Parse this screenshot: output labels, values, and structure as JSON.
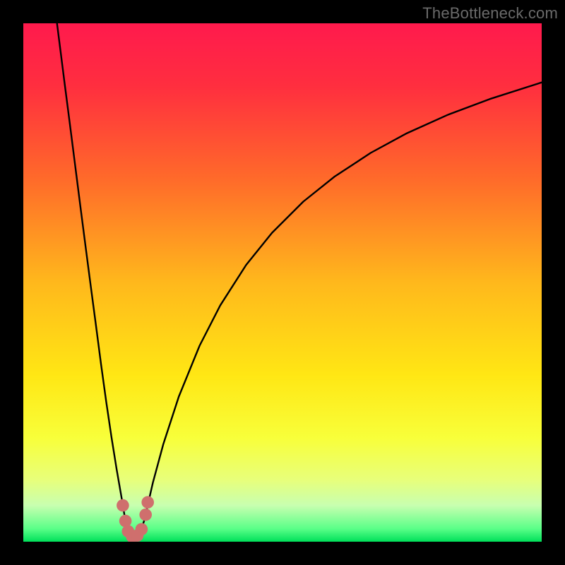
{
  "watermark": "TheBottleneck.com",
  "colors": {
    "frame": "#000000",
    "curve_stroke": "#000000",
    "marker_fill": "#cf6f6d",
    "gradient_stops": [
      {
        "offset": 0.0,
        "color": "#ff1a4d"
      },
      {
        "offset": 0.12,
        "color": "#ff2e3f"
      },
      {
        "offset": 0.3,
        "color": "#ff6a2a"
      },
      {
        "offset": 0.5,
        "color": "#ffb81c"
      },
      {
        "offset": 0.68,
        "color": "#ffe714"
      },
      {
        "offset": 0.8,
        "color": "#f8ff3a"
      },
      {
        "offset": 0.88,
        "color": "#e8ff7a"
      },
      {
        "offset": 0.93,
        "color": "#c8ffb0"
      },
      {
        "offset": 0.975,
        "color": "#5aff88"
      },
      {
        "offset": 1.0,
        "color": "#00e05a"
      }
    ]
  },
  "chart_data": {
    "type": "line",
    "title": "",
    "xlabel": "",
    "ylabel": "",
    "xlim": [
      0,
      100
    ],
    "ylim": [
      0,
      100
    ],
    "series": [
      {
        "name": "left-branch",
        "x": [
          6.5,
          8,
          9,
          10,
          11,
          12,
          13,
          14,
          15,
          16,
          17,
          18,
          19,
          19.7
        ],
        "y": [
          100,
          88.2,
          80.4,
          72.6,
          64.8,
          57.0,
          49.4,
          41.8,
          34.2,
          27.0,
          20.2,
          14.0,
          8.2,
          4.0
        ]
      },
      {
        "name": "floor",
        "x": [
          19.7,
          20.5,
          21.5,
          22.5,
          23.3
        ],
        "y": [
          4.0,
          1.6,
          1.0,
          1.6,
          4.0
        ]
      },
      {
        "name": "right-branch",
        "x": [
          23.3,
          25,
          27,
          30,
          34,
          38,
          43,
          48,
          54,
          60,
          67,
          74,
          82,
          90,
          100
        ],
        "y": [
          4.0,
          11.4,
          18.8,
          28.0,
          37.8,
          45.6,
          53.4,
          59.6,
          65.6,
          70.4,
          75.0,
          78.8,
          82.4,
          85.4,
          88.6
        ]
      }
    ],
    "markers": [
      {
        "x": 19.2,
        "y": 7.0,
        "r": 1.2
      },
      {
        "x": 19.7,
        "y": 4.0,
        "r": 1.2
      },
      {
        "x": 20.2,
        "y": 2.0,
        "r": 1.2
      },
      {
        "x": 21.0,
        "y": 1.0,
        "r": 1.2
      },
      {
        "x": 22.0,
        "y": 1.2,
        "r": 1.2
      },
      {
        "x": 22.8,
        "y": 2.4,
        "r": 1.2
      },
      {
        "x": 23.6,
        "y": 5.2,
        "r": 1.2
      },
      {
        "x": 24.0,
        "y": 7.6,
        "r": 1.2
      }
    ]
  }
}
